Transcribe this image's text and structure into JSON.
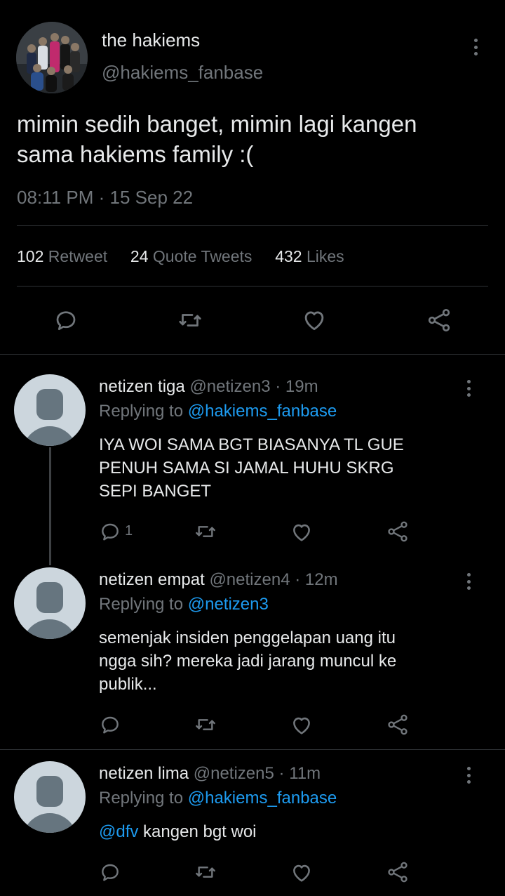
{
  "tweet": {
    "display_name": "the hakiems",
    "handle": "@hakiems_fanbase",
    "text_line1": "mimin sedih banget, mimin lagi kangen",
    "text_line2": "sama hakiems family :(",
    "time": "08:11 PM",
    "separator": "·",
    "date": "15 Sep 22",
    "stats": {
      "retweets_count": "102",
      "retweets_label": "Retweet",
      "quotes_count": "24",
      "quotes_label": "Quote Tweets",
      "likes_count": "432",
      "likes_label": "Likes"
    }
  },
  "replies": [
    {
      "name": "netizen tiga",
      "handle": "@netizen3",
      "sep": "·",
      "age": "19m",
      "replying_label": "Replying to",
      "replying_to": "@hakiems_fanbase",
      "lines": [
        "IYA WOI SAMA BGT BIASANYA TL GUE",
        "PENUH SAMA SI JAMAL HUHU SKRG",
        "SEPI BANGET"
      ],
      "reply_count": "1"
    },
    {
      "name": "netizen empat",
      "handle": "@netizen4",
      "sep": "·",
      "age": "12m",
      "replying_label": "Replying to",
      "replying_to": "@netizen3",
      "lines": [
        "semenjak insiden penggelapan uang itu",
        "ngga sih? mereka jadi jarang muncul ke",
        "publik..."
      ]
    },
    {
      "name": "netizen lima",
      "handle": "@netizen5",
      "sep": "·",
      "age": "11m",
      "replying_label": "Replying to",
      "replying_to": "@hakiems_fanbase",
      "mention": "@dfv",
      "text": " kangen bgt woi"
    }
  ],
  "icons": {
    "more": "more-vertical-icon",
    "reply": "reply-bubble-icon",
    "retweet": "retweet-icon",
    "like": "heart-icon",
    "share": "share-icon"
  },
  "colors": {
    "background": "#000000",
    "text": "#e7e9ea",
    "muted": "#71767b",
    "link": "#1d9bf0",
    "divider": "#2f3336"
  }
}
